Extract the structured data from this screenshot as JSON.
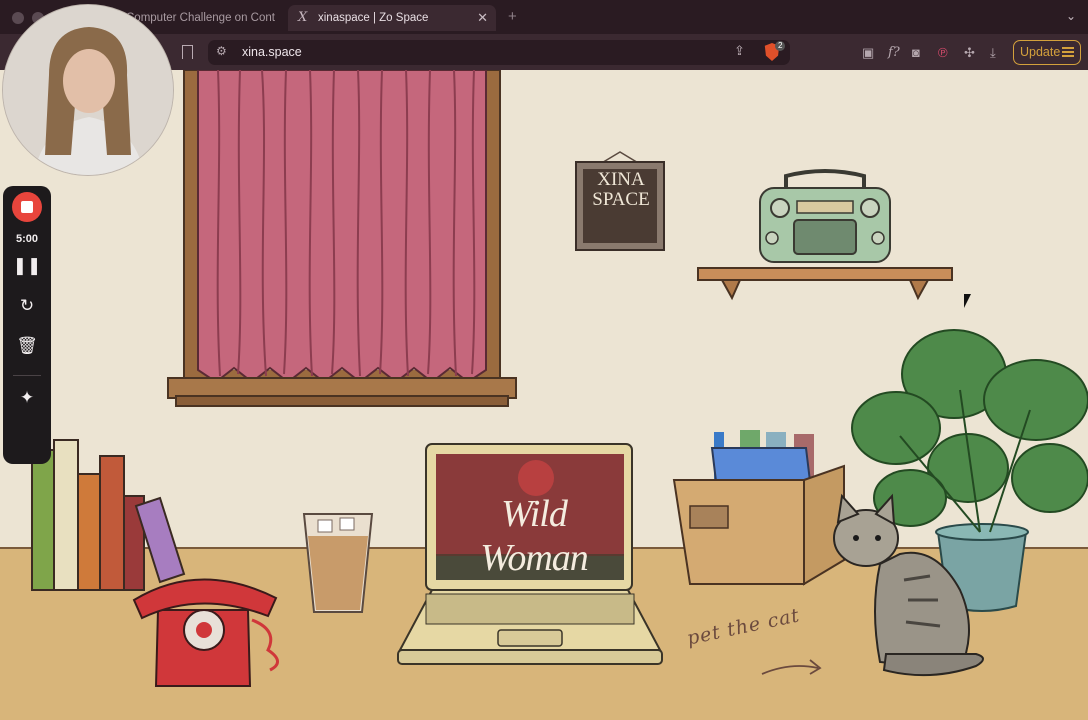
{
  "browser": {
    "tabs": [
      {
        "title": "Computer Challenge on Cont",
        "favicon": "tab-favicon"
      },
      {
        "title": "xinaspace | Zo Space",
        "favicon": "x-logo-favicon",
        "active": true
      }
    ],
    "url": "xina.space",
    "brave_badge": "2",
    "update_label": "Update"
  },
  "room": {
    "sign_line1": "XINA",
    "sign_line2": "SPACE",
    "laptop_screen_title": "Wild Woman",
    "cta": "pet the cat"
  },
  "recorder": {
    "timer": "5:00",
    "controls": [
      "stop-icon",
      "pause-icon",
      "restart-icon",
      "trash-icon",
      "confetti-icon"
    ]
  },
  "colors": {
    "tab_bg": "#2a1b22",
    "toolbar_bg": "#3b2931",
    "update_accent": "#d4a13c",
    "wall": "#ece4d3",
    "floor": "#d8b57a",
    "curtain": "#c5677c",
    "record_red": "#e8453c"
  }
}
